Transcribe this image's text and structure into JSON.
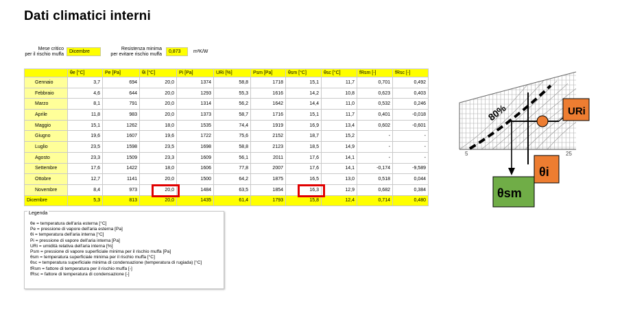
{
  "title": "Dati climatici  interni",
  "params": {
    "mese_label_1": "Mese critico",
    "mese_label_2": "per il rischio muffa",
    "mese_value": "Dicembre",
    "resist_label_1": "Resistenza minima",
    "resist_label_2": "per evitare rischio muffa",
    "resist_value": "0,873",
    "resist_unit": "m²K/W"
  },
  "table": {
    "headers": [
      "",
      "θe [°C]",
      "Pe [Pa]",
      "θi [°C]",
      "Pi [Pa]",
      "URi [%]",
      "Psm [Pa]",
      "θsm [°C]",
      "θsc [°C]",
      "fRsm [-]",
      "fRsc [-]"
    ],
    "rows": [
      [
        "Gennaio",
        "3,7",
        "694",
        "20,0",
        "1374",
        "58,8",
        "1718",
        "15,1",
        "11,7",
        "0,701",
        "0,492"
      ],
      [
        "Febbraio",
        "4,6",
        "644",
        "20,0",
        "1293",
        "55,3",
        "1616",
        "14,2",
        "10,8",
        "0,623",
        "0,403"
      ],
      [
        "Marzo",
        "8,1",
        "791",
        "20,0",
        "1314",
        "56,2",
        "1642",
        "14,4",
        "11,0",
        "0,532",
        "0,246"
      ],
      [
        "Aprile",
        "11,8",
        "983",
        "20,0",
        "1373",
        "58,7",
        "1716",
        "15,1",
        "11,7",
        "0,401",
        "-0,018"
      ],
      [
        "Maggio",
        "15,1",
        "1262",
        "18,0",
        "1535",
        "74,4",
        "1919",
        "16,9",
        "13,4",
        "0,602",
        "-0,601"
      ],
      [
        "Giugno",
        "19,6",
        "1607",
        "19,6",
        "1722",
        "75,6",
        "2152",
        "18,7",
        "15,2",
        "-",
        "-"
      ],
      [
        "Luglio",
        "23,5",
        "1598",
        "23,5",
        "1698",
        "58,8",
        "2123",
        "18,5",
        "14,9",
        "-",
        "-"
      ],
      [
        "Agosto",
        "23,3",
        "1509",
        "23,3",
        "1609",
        "56,1",
        "2011",
        "17,6",
        "14,1",
        "-",
        "-"
      ],
      [
        "Settembre",
        "17,6",
        "1422",
        "18,0",
        "1606",
        "77,8",
        "2007",
        "17,6",
        "14,1",
        "-0,174",
        "-9,589"
      ],
      [
        "Ottobre",
        "12,7",
        "1141",
        "20,0",
        "1500",
        "64,2",
        "1875",
        "16,5",
        "13,0",
        "0,518",
        "0,044"
      ],
      [
        "Novembre",
        "8,4",
        "973",
        "20,0",
        "1484",
        "63,5",
        "1854",
        "16,3",
        "12,9",
        "0,682",
        "0,384"
      ],
      [
        "Dicembre",
        "5,3",
        "813",
        "20,0",
        "1435",
        "61,4",
        "1793",
        "15,8",
        "12,4",
        "0,714",
        "0,480"
      ]
    ]
  },
  "legend": {
    "title": "Legenda",
    "lines": [
      "θe = temperatura dell'aria esterna [°C]",
      "Pe = pressione di vapore dell'aria esterna [Pa]",
      "θi = temperatura dell'aria interna [°C]",
      "Pi = pressione di vapore dell'aria interna [Pa]",
      "URi = umidità relativa dell'aria interna [%]",
      "Psm = pressione di vapore superficiale minima per il rischio muffa [Pa]",
      "θsm = temperatura superficiale minima per il rischio muffa [°C]",
      "θsc = temperatura superficiale minima di condensazione (temperatura di rugiada) [°C]",
      "fRsm = fattore di temperatura per il rischio muffa [-]",
      "fRsc = fattore di temperatura di condensazione [-]"
    ]
  },
  "diagram": {
    "curve_label": "80%",
    "ur_label": "URi",
    "theta_i_label": "θi",
    "theta_sm_label": "θsm",
    "axis_tick_5": "5",
    "axis_tick_25": "25",
    "colors": {
      "orange": "#ed7d31",
      "green": "#70ad47"
    }
  }
}
